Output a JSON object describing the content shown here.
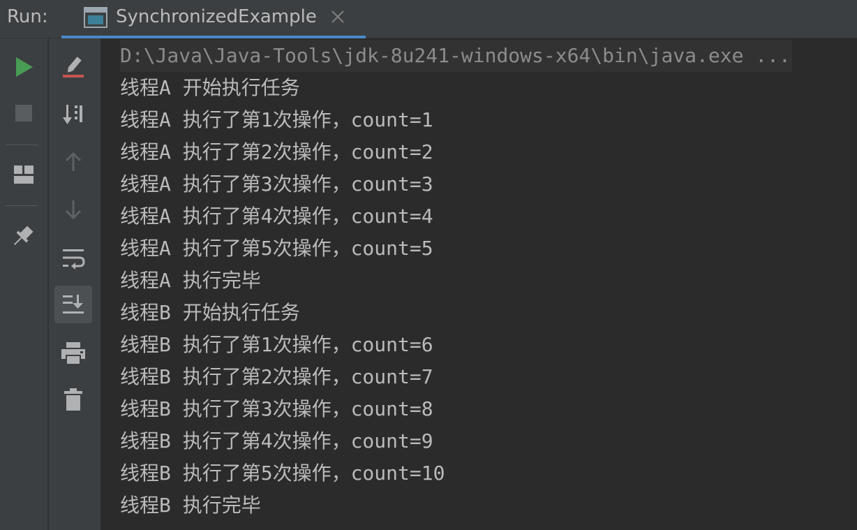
{
  "header": {
    "run_label": "Run:",
    "tab": {
      "title": "SynchronizedExample",
      "icon": "console-window-icon",
      "close_icon": "close-icon"
    }
  },
  "toolbar": {
    "left": [
      "run-icon",
      "stop-icon",
      "layout-icon",
      "pin-icon"
    ],
    "right": [
      "clear-output-icon",
      "sort-icon",
      "arrow-up-icon",
      "arrow-down-icon",
      "soft-wrap-icon",
      "scroll-to-end-icon",
      "print-icon",
      "trash-icon"
    ]
  },
  "console": {
    "command": "D:\\Java\\Java-Tools\\jdk-8u241-windows-x64\\bin\\java.exe ...",
    "lines": [
      "线程A 开始执行任务",
      "线程A 执行了第1次操作，count=1",
      "线程A 执行了第2次操作，count=2",
      "线程A 执行了第3次操作，count=3",
      "线程A 执行了第4次操作，count=4",
      "线程A 执行了第5次操作，count=5",
      "线程A 执行完毕",
      "线程B 开始执行任务",
      "线程B 执行了第1次操作，count=6",
      "线程B 执行了第2次操作，count=7",
      "线程B 执行了第3次操作，count=8",
      "线程B 执行了第4次操作，count=9",
      "线程B 执行了第5次操作，count=10",
      "线程B 执行完毕"
    ]
  },
  "colors": {
    "background": "#2b2b2b",
    "panel": "#3c3f41",
    "accent": "#4a88c7",
    "run_green": "#499c54",
    "text": "#bbbbbb",
    "command_text": "#8c8c8c"
  }
}
